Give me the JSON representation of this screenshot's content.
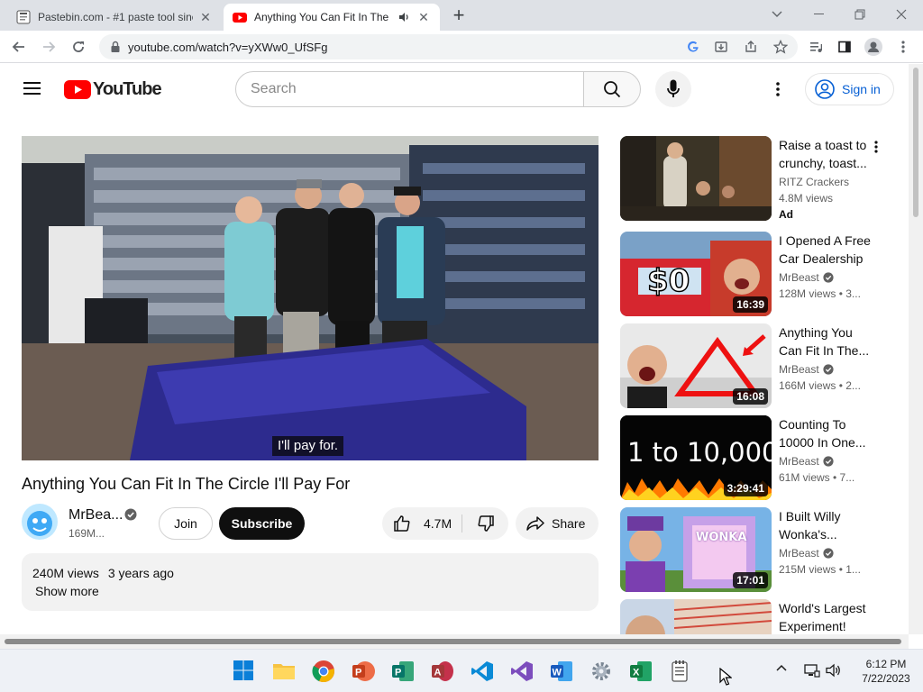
{
  "browser": {
    "tabs": [
      {
        "title": "Pastebin.com - #1 paste tool since",
        "active": false
      },
      {
        "title": "Anything You Can Fit In The",
        "active": true
      }
    ],
    "url": "youtube.com/watch?v=yXWw0_UfSFg"
  },
  "header": {
    "logo_text": "YouTube",
    "search_placeholder": "Search",
    "signin_label": "Sign in"
  },
  "video": {
    "caption": "I'll pay for.",
    "title": "Anything You Can Fit In The Circle I'll Pay For",
    "channel": "MrBea...",
    "subscribers": "169M...",
    "join_label": "Join",
    "subscribe_label": "Subscribe",
    "likes": "4.7M",
    "share_label": "Share",
    "views": "240M views",
    "age": "3 years ago",
    "show_more": "Show more"
  },
  "recommendations": [
    {
      "title": "Raise a toast to crunchy, toast...",
      "channel": "RITZ Crackers",
      "views": "4.8M views",
      "ad": "Ad",
      "duration": "",
      "verified": false
    },
    {
      "title": "I Opened A Free Car Dealership",
      "channel": "MrBeast",
      "views": "128M views  • 3...",
      "duration": "16:39",
      "verified": true
    },
    {
      "title": "Anything You Can Fit In The...",
      "channel": "MrBeast",
      "views": "166M views  • 2...",
      "duration": "16:08",
      "verified": true
    },
    {
      "title": "Counting To 10000 In One...",
      "channel": "MrBeast",
      "views": "61M views  • 7...",
      "duration": "3:29:41",
      "verified": true,
      "thumb_text": "1 to 10,000"
    },
    {
      "title": "I Built Willy Wonka's...",
      "channel": "MrBeast",
      "views": "215M views  • 1...",
      "duration": "17:01",
      "verified": true,
      "thumb_text": "WONKA"
    },
    {
      "title": "World's Largest Experiment!",
      "channel": "",
      "views": "",
      "duration": "",
      "verified": false
    }
  ],
  "taskbar": {
    "time": "6:12 PM",
    "date": "7/22/2023"
  }
}
